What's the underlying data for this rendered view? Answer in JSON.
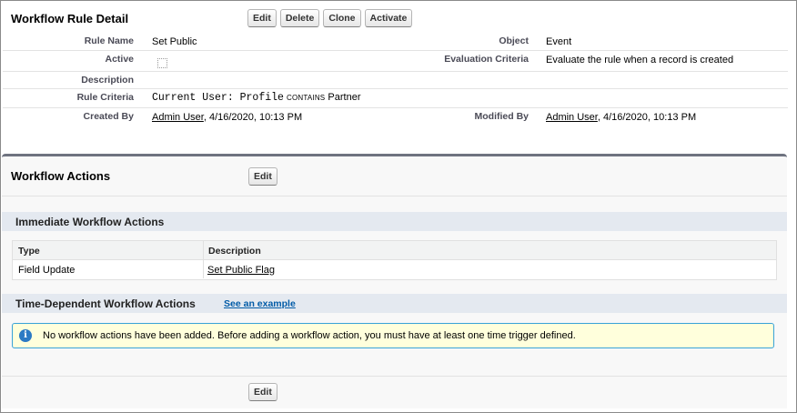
{
  "detail": {
    "title": "Workflow Rule Detail",
    "buttons": [
      "Edit",
      "Delete",
      "Clone",
      "Activate"
    ],
    "fields": {
      "rule_name_label": "Rule Name",
      "rule_name": "Set Public",
      "object_label": "Object",
      "object": "Event",
      "active_label": "Active",
      "active_checked": false,
      "eval_label": "Evaluation Criteria",
      "eval": "Evaluate the rule when a record is created",
      "description_label": "Description",
      "description": "",
      "criteria_label": "Rule Criteria",
      "criteria_field": "Current User: Profile",
      "criteria_operator": "contains",
      "criteria_value": "Partner",
      "created_label": "Created By",
      "created_user": "Admin User",
      "created_date": ", 4/16/2020, 10:13 PM",
      "modified_label": "Modified By",
      "modified_user": "Admin User",
      "modified_date": ", 4/16/2020, 10:13 PM"
    }
  },
  "actions": {
    "title": "Workflow Actions",
    "edit_label": "Edit",
    "immediate": {
      "title": "Immediate Workflow Actions",
      "columns": [
        "Type",
        "Description"
      ],
      "rows": [
        {
          "type": "Field Update",
          "description": "Set Public Flag"
        }
      ]
    },
    "time_dependent": {
      "title": "Time-Dependent Workflow Actions",
      "example_link": "See an example",
      "info_icon": "info-icon",
      "message": "No workflow actions have been added. Before adding a workflow action, you must have at least one time trigger defined."
    },
    "bottom_edit_label": "Edit"
  },
  "colors": {
    "section_header_bg": "#e4e9f0",
    "info_bg": "#ffffdc",
    "info_border": "#39a3d8",
    "link": "#015ba7",
    "panel_top_border": "#6f7380"
  }
}
